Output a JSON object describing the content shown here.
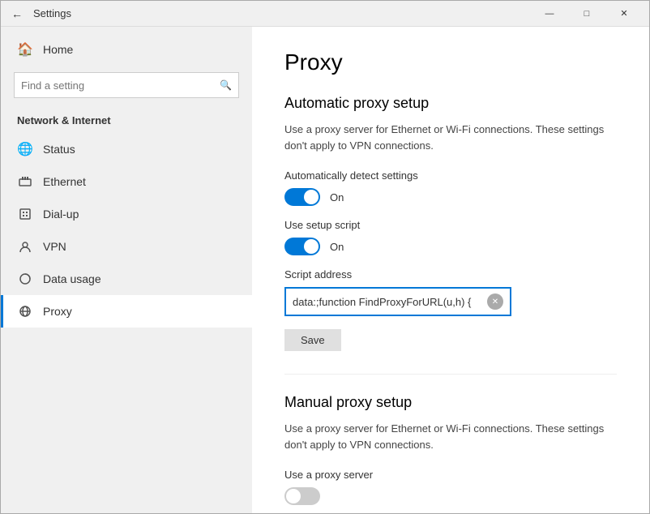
{
  "window": {
    "title": "Settings"
  },
  "titlebar": {
    "back_label": "←",
    "title": "Settings",
    "minimize": "—",
    "maximize": "□",
    "close": "✕"
  },
  "sidebar": {
    "home_label": "Home",
    "search_placeholder": "Find a setting",
    "section_title": "Network & Internet",
    "items": [
      {
        "id": "status",
        "label": "Status",
        "icon": "🌐"
      },
      {
        "id": "ethernet",
        "label": "Ethernet",
        "icon": "🖥"
      },
      {
        "id": "dialup",
        "label": "Dial-up",
        "icon": "☎"
      },
      {
        "id": "vpn",
        "label": "VPN",
        "icon": "🔒"
      },
      {
        "id": "datausage",
        "label": "Data usage",
        "icon": "📊"
      },
      {
        "id": "proxy",
        "label": "Proxy",
        "icon": "🌍"
      }
    ]
  },
  "main": {
    "page_title": "Proxy",
    "auto_section_title": "Automatic proxy setup",
    "auto_description": "Use a proxy server for Ethernet or Wi-Fi connections. These settings don't apply to VPN connections.",
    "auto_detect_label": "Automatically detect settings",
    "auto_detect_state": "On",
    "setup_script_label": "Use setup script",
    "setup_script_state": "On",
    "script_address_label": "Script address",
    "script_address_value": "data:;function FindProxyForURL(u,h) {",
    "save_label": "Save",
    "manual_section_title": "Manual proxy setup",
    "manual_description": "Use a proxy server for Ethernet or Wi-Fi connections. These settings don't apply to VPN connections.",
    "use_proxy_label": "Use a proxy server"
  }
}
